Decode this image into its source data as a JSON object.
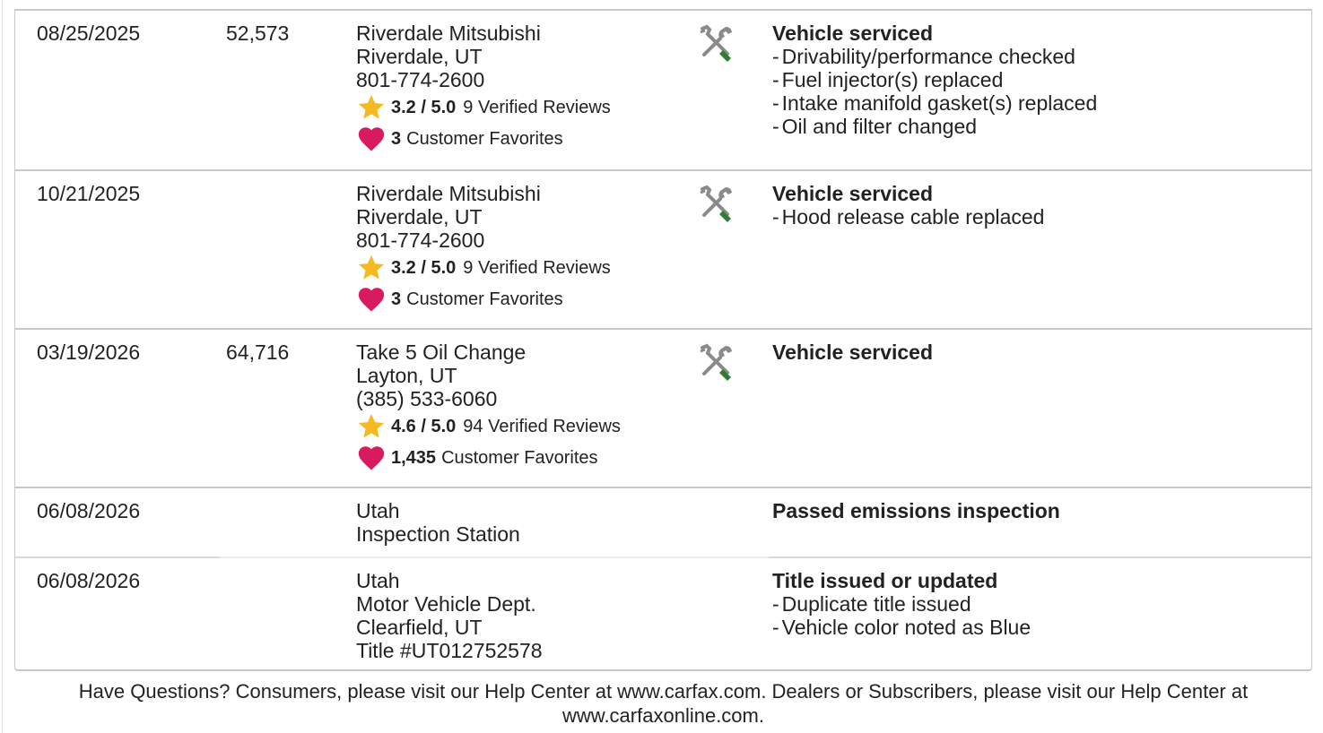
{
  "records": [
    {
      "date": "08/25/2025",
      "odometer": "52,573",
      "source": [
        "Riverdale Mitsubishi",
        "Riverdale, UT",
        "801-774-2600"
      ],
      "rating": "3.2 / 5.0",
      "reviews": "9 Verified Reviews",
      "favorites_count": "3",
      "favorites_label": "Customer Favorites",
      "icon": "service-tools-icon",
      "title": "Vehicle serviced",
      "items": [
        "Drivability/performance checked",
        "Fuel injector(s) replaced",
        "Intake manifold gasket(s) replaced",
        "Oil and filter changed"
      ]
    },
    {
      "date": "10/21/2025",
      "odometer": "",
      "source": [
        "Riverdale Mitsubishi",
        "Riverdale, UT",
        "801-774-2600"
      ],
      "rating": "3.2 / 5.0",
      "reviews": "9 Verified Reviews",
      "favorites_count": "3",
      "favorites_label": "Customer Favorites",
      "icon": "service-tools-icon",
      "title": "Vehicle serviced",
      "items": [
        "Hood release cable replaced"
      ]
    },
    {
      "date": "03/19/2026",
      "odometer": "64,716",
      "source": [
        "Take 5 Oil Change",
        "Layton, UT",
        "(385) 533-6060"
      ],
      "rating": "4.6 / 5.0",
      "reviews": "94 Verified Reviews",
      "favorites_count": "1,435",
      "favorites_label": "Customer Favorites",
      "icon": "service-tools-icon",
      "title": "Vehicle serviced",
      "items": []
    },
    {
      "date": "06/08/2026",
      "odometer": "",
      "source": [
        "Utah",
        "Inspection Station"
      ],
      "title": "Passed emissions inspection",
      "items": []
    },
    {
      "date": "06/08/2026",
      "odometer": "",
      "source": [
        "Utah",
        "Motor Vehicle Dept.",
        "Clearfield, UT",
        "Title #UT012752578"
      ],
      "title": "Title issued or updated",
      "items": [
        "Duplicate title issued",
        "Vehicle color noted as Blue"
      ]
    }
  ],
  "dash": "-",
  "footer": {
    "line1": "Have Questions? Consumers, please visit our Help Center at www.carfax.com. Dealers or Subscribers, please visit our Help Center at",
    "line2": "www.carfaxonline.com."
  },
  "colors": {
    "star": "#f5b921",
    "heart": "#d81b60",
    "wrench": "#8a8a8a",
    "screwdriver": "#2e7d32",
    "border": "#c8c8c8"
  }
}
